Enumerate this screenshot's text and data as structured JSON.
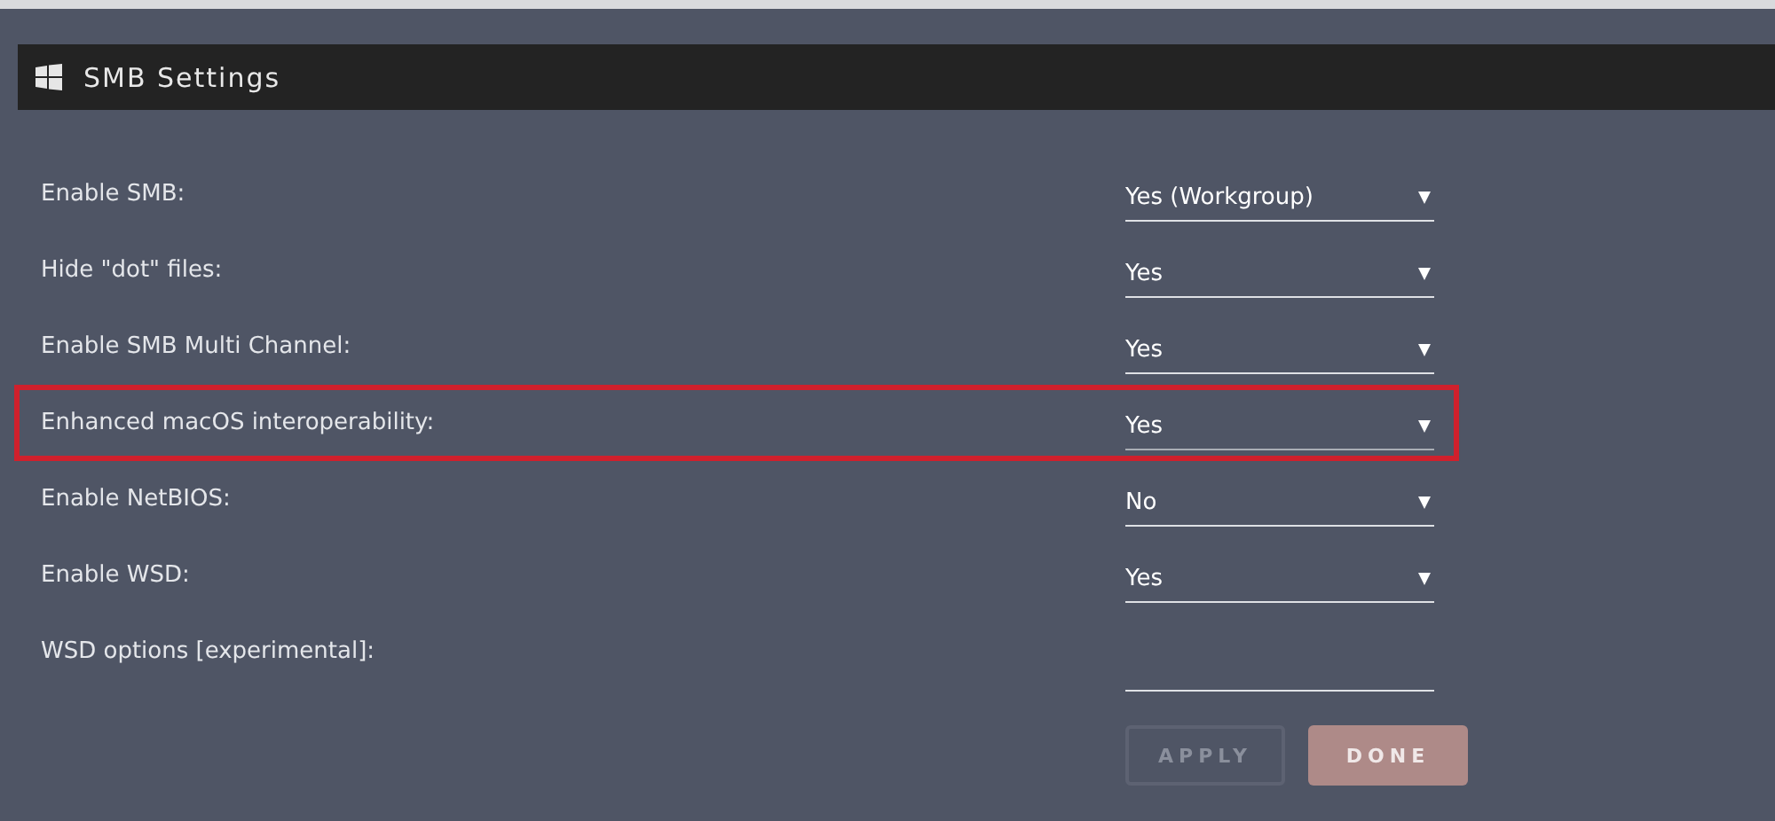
{
  "panel": {
    "title": "SMB Settings"
  },
  "settings": [
    {
      "label": "Enable SMB:",
      "kind": "select",
      "value": "Yes (Workgroup)",
      "highlighted": false
    },
    {
      "label": "Hide \"dot\" files:",
      "kind": "select",
      "value": "Yes",
      "highlighted": false
    },
    {
      "label": "Enable SMB Multi Channel:",
      "kind": "select",
      "value": "Yes",
      "highlighted": false
    },
    {
      "label": "Enhanced macOS interoperability:",
      "kind": "select",
      "value": "Yes",
      "highlighted": true
    },
    {
      "label": "Enable NetBIOS:",
      "kind": "select",
      "value": "No",
      "highlighted": false
    },
    {
      "label": "Enable WSD:",
      "kind": "select",
      "value": "Yes",
      "highlighted": false
    },
    {
      "label": "WSD options [experimental]:",
      "kind": "text",
      "highlighted": false
    }
  ],
  "buttons": [
    {
      "label": "APPLY",
      "disabled": true
    },
    {
      "label": "DONE",
      "disabled": false
    }
  ]
}
